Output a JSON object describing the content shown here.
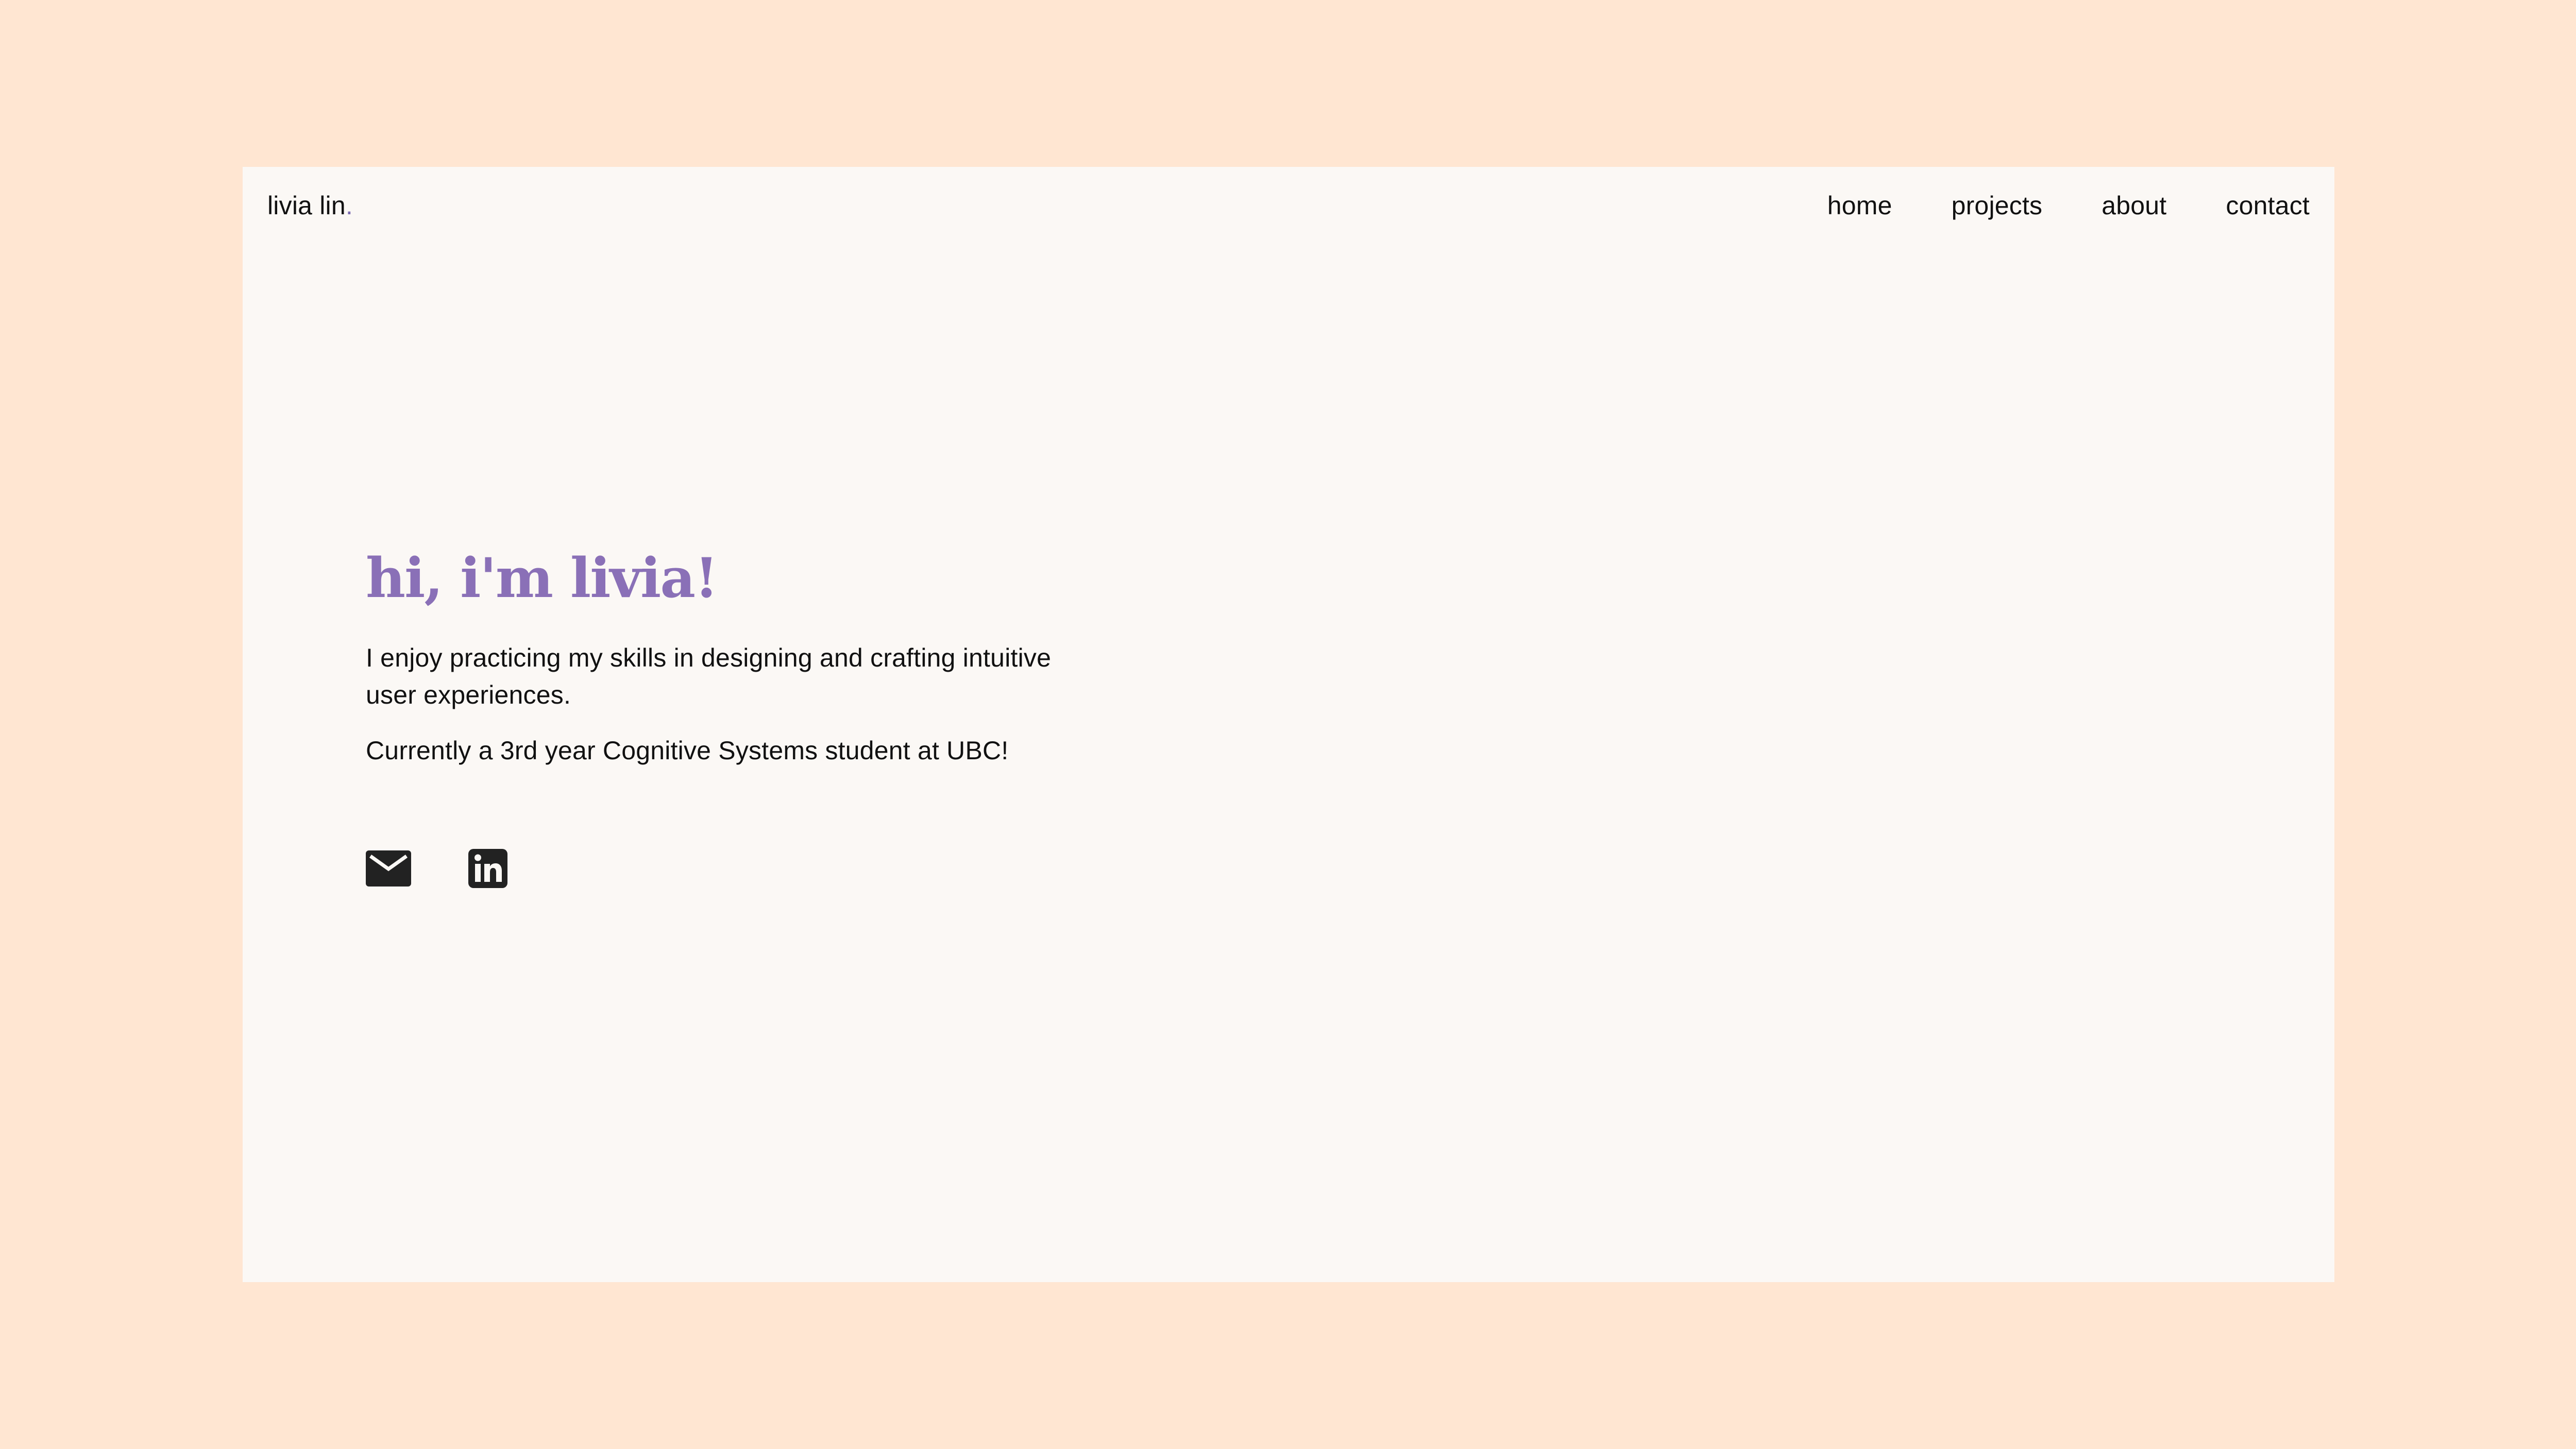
{
  "brand": {
    "name": "livia lin",
    "dot": "."
  },
  "nav": {
    "items": [
      {
        "label": "home"
      },
      {
        "label": "projects"
      },
      {
        "label": "about"
      },
      {
        "label": "contact"
      }
    ]
  },
  "hero": {
    "heading": "hi, i'm livia!",
    "paragraph_1": "I enjoy practicing my skills in designing and crafting intuitive user experiences.",
    "paragraph_2": "Currently a 3rd year Cognitive Systems student at UBC!"
  },
  "socials": {
    "items": [
      {
        "icon": "mail-icon"
      },
      {
        "icon": "linkedin-icon"
      }
    ]
  },
  "colors": {
    "page_background": "#FFE6D2",
    "card_background": "#FBF8F5",
    "heading_accent": "#8A70B7",
    "text": "#111111",
    "icon": "#222222"
  }
}
